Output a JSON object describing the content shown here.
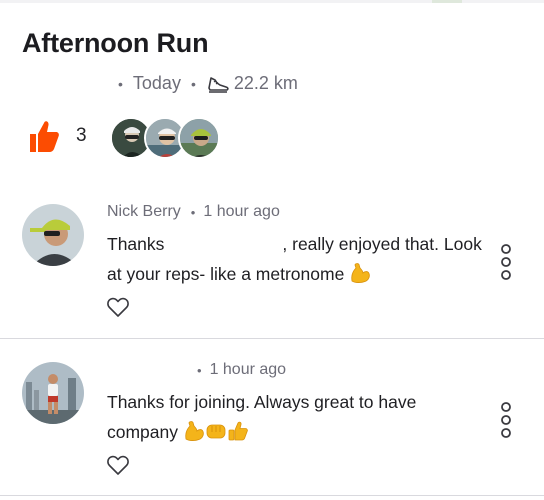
{
  "activity": {
    "title": "Afternoon Run",
    "date": "Today",
    "distance": "22.2 km"
  },
  "kudos": {
    "count": "3",
    "color": "#fc4c02"
  },
  "comments": [
    {
      "author": "Nick Berry",
      "time": "1 hour ago",
      "text_before": "Thanks",
      "text_after": ", really enjoyed that. Look at your reps- like a metronome",
      "emojis": [
        "flexed-biceps"
      ]
    },
    {
      "author": "",
      "time": "1 hour ago",
      "text": "Thanks for joining. Always great to have company",
      "emojis": [
        "flexed-biceps",
        "oncoming-fist",
        "thumbs-up"
      ]
    }
  ],
  "icons": {
    "distance": "running-shoe-icon",
    "kudos": "thumbs-up-icon",
    "like": "heart-outline-icon",
    "more": "more-vertical-icon"
  },
  "colors": {
    "emoji_yellow": "#f4b41a",
    "divider": "#d9d9de",
    "meta_gray": "#6d6d78"
  }
}
